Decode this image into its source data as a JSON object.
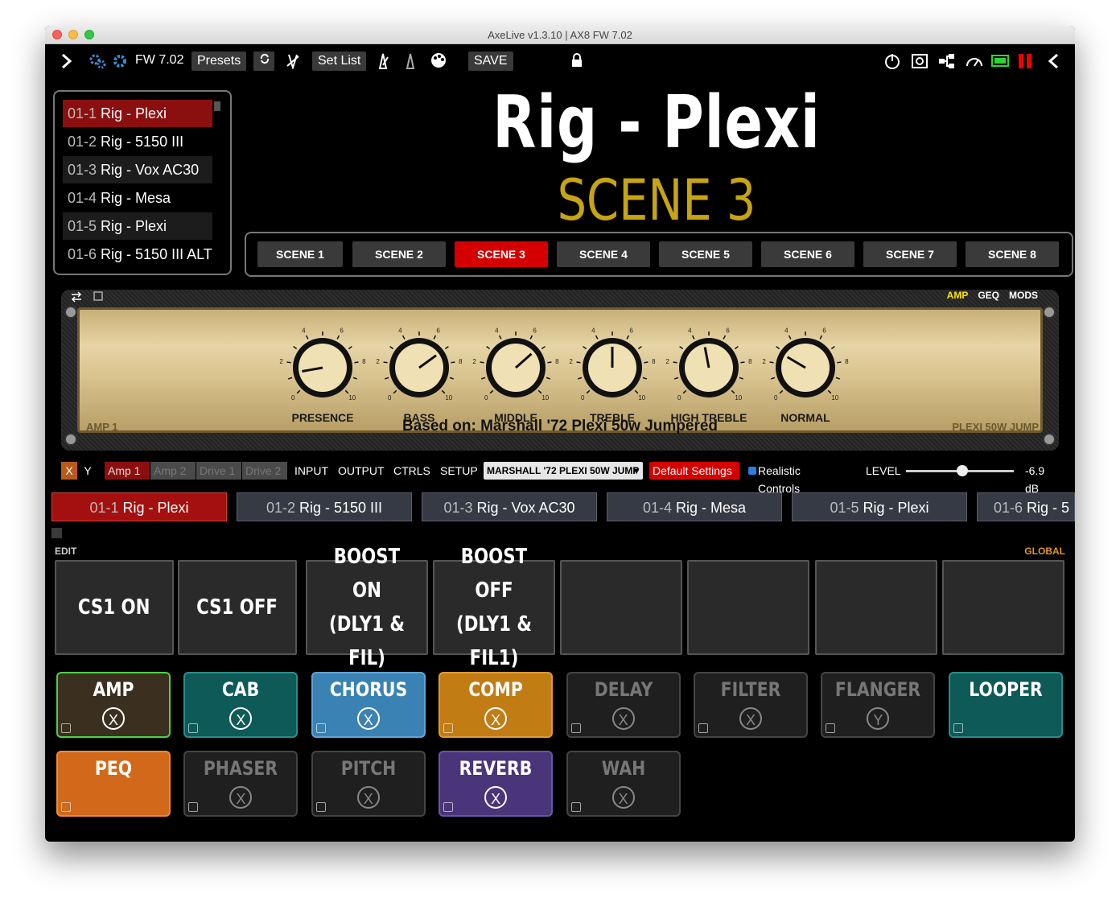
{
  "window": {
    "title": "AxeLive v1.3.10 | AX8 FW 7.02"
  },
  "toolbar": {
    "fw": "FW 7.02",
    "presets": "Presets",
    "set_list": "Set List",
    "save": "SAVE"
  },
  "preset_list": [
    {
      "num": "01-1",
      "name": "Rig - Plexi"
    },
    {
      "num": "01-2",
      "name": "Rig - 5150 III"
    },
    {
      "num": "01-3",
      "name": "Rig - Vox AC30"
    },
    {
      "num": "01-4",
      "name": "Rig - Mesa"
    },
    {
      "num": "01-5",
      "name": "Rig - Plexi"
    },
    {
      "num": "01-6",
      "name": "Rig - 5150 III ALT"
    }
  ],
  "header": {
    "preset_name": "Rig - Plexi",
    "scene_name": "SCENE 3"
  },
  "scenes": [
    "SCENE 1",
    "SCENE 2",
    "SCENE 3",
    "SCENE 4",
    "SCENE 5",
    "SCENE 6",
    "SCENE 7",
    "SCENE 8"
  ],
  "amp": {
    "tabs": [
      "AMP",
      "GEQ",
      "MODS"
    ],
    "knobs": [
      {
        "label": "PRESENCE",
        "value": 1.3
      },
      {
        "label": "BASS",
        "value": 7.0
      },
      {
        "label": "MIDDLE",
        "value": 6.8
      },
      {
        "label": "TREBLE",
        "value": 5.0
      },
      {
        "label": "HIGH TREBLE",
        "value": 4.6
      },
      {
        "label": "NORMAL",
        "value": 2.8
      }
    ],
    "scale": [
      "0",
      "2",
      "4",
      "6",
      "8",
      "10"
    ],
    "based_on": "Based on: Marshall '72 Plexi 50w Jumpered",
    "name_left": "AMP 1",
    "name_right": "PLEXI 50W JUMP"
  },
  "controls": {
    "x": "X",
    "y": "Y",
    "amp1": "Amp 1",
    "amp2": "Amp 2",
    "drive1": "Drive 1",
    "drive2": "Drive 2",
    "input": "INPUT",
    "output": "OUTPUT",
    "ctrls": "CTRLS",
    "setup": "SETUP",
    "amp_model": "MARSHALL '72 PLEXI 50W JUMP",
    "default_settings": "Default Settings",
    "realistic": "Realistic Controls",
    "level_label": "LEVEL",
    "level_value": "-6.9 dB",
    "level_fraction": 0.52
  },
  "preset_strip": [
    {
      "num": "01-1",
      "name": "Rig - Plexi"
    },
    {
      "num": "01-2",
      "name": "Rig - 5150 III"
    },
    {
      "num": "01-3",
      "name": "Rig - Vox AC30"
    },
    {
      "num": "01-4",
      "name": "Rig - Mesa"
    },
    {
      "num": "01-5",
      "name": "Rig - Plexi"
    },
    {
      "num": "01-6",
      "name": "Rig - 5"
    }
  ],
  "edit_label": "EDIT",
  "global_label": "GLOBAL",
  "switches": [
    "CS1 ON",
    "CS1 OFF",
    "BOOST ON\n(DLY1 &\nFIL)",
    "BOOST OFF\n(DLY1 &\nFIL1)",
    "",
    "",
    "",
    ""
  ],
  "blocks": [
    {
      "name": "AMP",
      "xy": "X",
      "state": "on",
      "color": "#3b3020",
      "border": "#4ad14a"
    },
    {
      "name": "CAB",
      "xy": "X",
      "state": "on",
      "color": "#0d5a58",
      "border": "#2b8c89"
    },
    {
      "name": "CHORUS",
      "xy": "X",
      "state": "on",
      "color": "#3b82b4",
      "border": "#5ea4d4"
    },
    {
      "name": "COMP",
      "xy": "X",
      "state": "on",
      "color": "#c17c14",
      "border": "#e09a33"
    },
    {
      "name": "DELAY",
      "xy": "X",
      "state": "off",
      "color": "#1f1f1f",
      "border": "#444"
    },
    {
      "name": "FILTER",
      "xy": "X",
      "state": "off",
      "color": "#1f1f1f",
      "border": "#444"
    },
    {
      "name": "FLANGER",
      "xy": "Y",
      "state": "off",
      "color": "#1f1f1f",
      "border": "#444"
    },
    {
      "name": "LOOPER",
      "xy": "",
      "state": "on",
      "color": "#0d5a58",
      "border": "#2b8c89"
    },
    {
      "name": "PEQ",
      "xy": "",
      "state": "on",
      "color": "#d2691a",
      "border": "#ef8a3a"
    },
    {
      "name": "PHASER",
      "xy": "X",
      "state": "off",
      "color": "#1f1f1f",
      "border": "#444"
    },
    {
      "name": "PITCH",
      "xy": "X",
      "state": "off",
      "color": "#1f1f1f",
      "border": "#444"
    },
    {
      "name": "REVERB",
      "xy": "X",
      "state": "on",
      "color": "#4a357a",
      "border": "#6b55a3"
    },
    {
      "name": "WAH",
      "xy": "X",
      "state": "off",
      "color": "#1f1f1f",
      "border": "#444"
    }
  ]
}
